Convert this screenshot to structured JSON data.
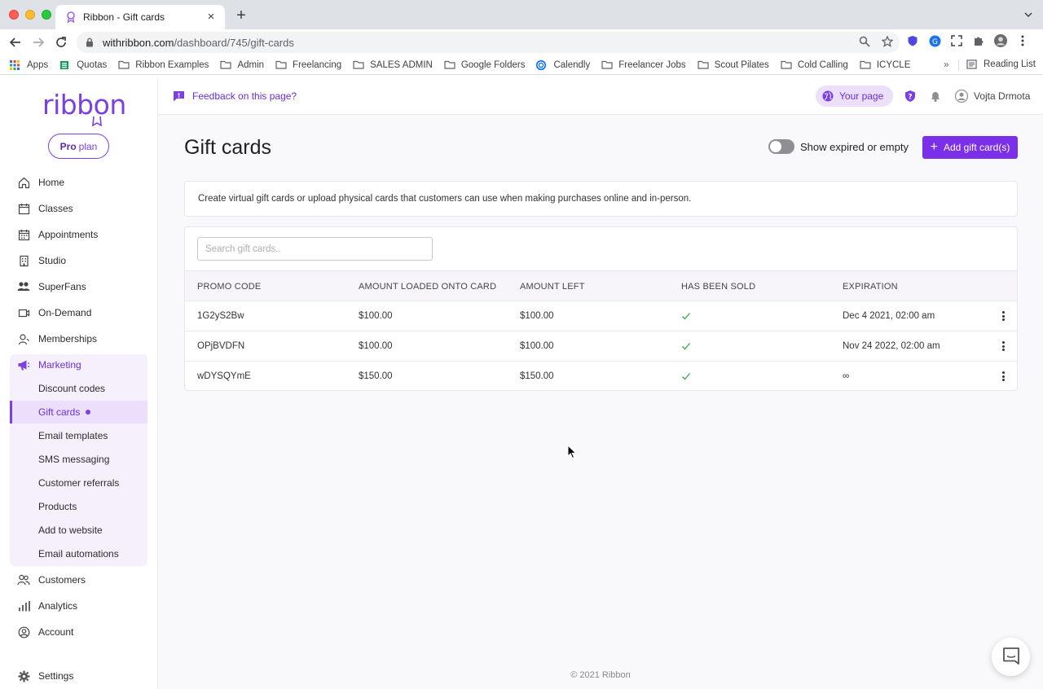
{
  "browser": {
    "tab_title": "Ribbon - Gift cards",
    "url_host": "withribbon.com",
    "url_path": "/dashboard/745/gift-cards",
    "bookmarks": [
      "Apps",
      "Quotas",
      "Ribbon Examples",
      "Admin",
      "Freelancing",
      "SALES ADMIN",
      "Google Folders",
      "Calendly",
      "Freelancer Jobs",
      "Scout Pilates",
      "Cold Calling",
      "ICYCLE"
    ],
    "more": "»",
    "reading_list": "Reading List"
  },
  "brand": {
    "logo": "ribbon",
    "plan_bold": "Pro",
    "plan_rest": "plan",
    "accent": "#7b3fe4"
  },
  "sidebar": {
    "items": [
      {
        "label": "Home",
        "icon": "home-icon"
      },
      {
        "label": "Classes",
        "icon": "calendar-icon"
      },
      {
        "label": "Appointments",
        "icon": "calendar-grid-icon"
      },
      {
        "label": "Studio",
        "icon": "building-icon"
      },
      {
        "label": "SuperFans",
        "icon": "users-icon"
      },
      {
        "label": "On-Demand",
        "icon": "video-icon"
      },
      {
        "label": "Memberships",
        "icon": "member-icon"
      },
      {
        "label": "Marketing",
        "icon": "megaphone-icon"
      }
    ],
    "marketing_sub": [
      "Discount codes",
      "Gift cards",
      "Email templates",
      "SMS messaging",
      "Customer referrals",
      "Products",
      "Add to website",
      "Email automations"
    ],
    "bottom": [
      {
        "label": "Customers",
        "icon": "customers-icon"
      },
      {
        "label": "Analytics",
        "icon": "analytics-icon"
      },
      {
        "label": "Account",
        "icon": "account-icon"
      },
      {
        "label": "Settings",
        "icon": "gear-icon"
      }
    ]
  },
  "topbar": {
    "feedback": "Feedback on this page?",
    "your_page": "Your page",
    "user_name": "Vojta Drmota"
  },
  "page": {
    "title": "Gift cards",
    "toggle_label": "Show expired or empty",
    "add_button": "Add gift card(s)",
    "info": "Create virtual gift cards or upload physical cards that customers can use when making purchases online and in-person.",
    "search_placeholder": "Search gift cards..",
    "columns": [
      "PROMO CODE",
      "AMOUNT LOADED ONTO CARD",
      "AMOUNT LEFT",
      "HAS BEEN SOLD",
      "EXPIRATION"
    ],
    "rows": [
      {
        "code": "1G2yS2Bw",
        "loaded": "$100.00",
        "left": "$100.00",
        "sold": true,
        "expiration": "Dec 4 2021, 02:00 am"
      },
      {
        "code": "OPjBVDFN",
        "loaded": "$100.00",
        "left": "$100.00",
        "sold": true,
        "expiration": "Nov 24 2022, 02:00 am"
      },
      {
        "code": "wDYSQYmE",
        "loaded": "$150.00",
        "left": "$150.00",
        "sold": true,
        "expiration": "∞"
      }
    ],
    "footer": "© 2021 Ribbon"
  }
}
